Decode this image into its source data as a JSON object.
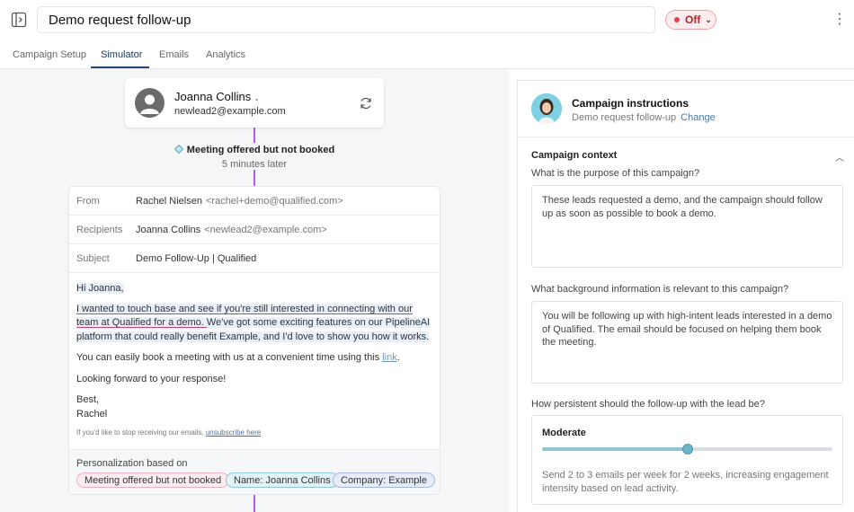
{
  "header": {
    "title": "Demo request follow-up",
    "status": "Off"
  },
  "tabs": [
    "Campaign Setup",
    "Simulator",
    "Emails",
    "Analytics"
  ],
  "lead": {
    "name": "Joanna Collins",
    "email": "newlead2@example.com"
  },
  "event": {
    "title": "Meeting offered but not booked",
    "delay": "5 minutes later"
  },
  "email": {
    "from_label": "From",
    "from_name": "Rachel Nielsen",
    "from_addr": "<rachel+demo@qualified.com>",
    "recipients_label": "Recipients",
    "recipients_name": "Joanna Collins",
    "recipients_addr": "<newlead2@example.com>",
    "subject_label": "Subject",
    "subject": "Demo Follow-Up | Qualified",
    "greeting": "Hi Joanna,",
    "p1_a": "I wanted to touch base and see if you're still interested in connecting with our team at Qualified for a demo. ",
    "p1_b": "We've got some exciting features on our PipelineAI platform that could really benefit Example, and I'd love to show you how it works.",
    "p2_a": "You can easily book a meeting with us at a convenient time using this ",
    "p2_link": "link",
    "p2_b": ".",
    "p3": "Looking forward to your response!",
    "signoff": "Best,",
    "signature": "Rachel",
    "footer_a": "If you'd like to stop receiving our emails, ",
    "footer_link": "unsubscribe here"
  },
  "personalization": {
    "label": "Personalization based on",
    "tags": [
      "Meeting offered but not booked",
      "Name: Joanna Collins",
      "Company: Example"
    ]
  },
  "instructions": {
    "title": "Campaign instructions",
    "campaign": "Demo request follow-up",
    "change": "Change",
    "context_title": "Campaign context",
    "q1": "What is the purpose of this campaign?",
    "a1": "These leads requested a demo, and the campaign should follow up as soon as possible to book a demo.",
    "q2": "What background information is relevant to this campaign?",
    "a2": "You will be following up with high-intent leads interested in a demo of Qualified. The email should be focused on helping them book the meeting.",
    "q3": "How persistent should the follow-up with the lead be?",
    "persistence_level": "Moderate",
    "persistence_fraction": 0.5,
    "persistence_desc": "Send 2 to 3 emails per week for 2 weeks, increasing engagement intensity based on lead activity."
  },
  "colors": {
    "accent": "#244a74",
    "flow_line": "#b15df0",
    "status_off": "#e0414d"
  }
}
